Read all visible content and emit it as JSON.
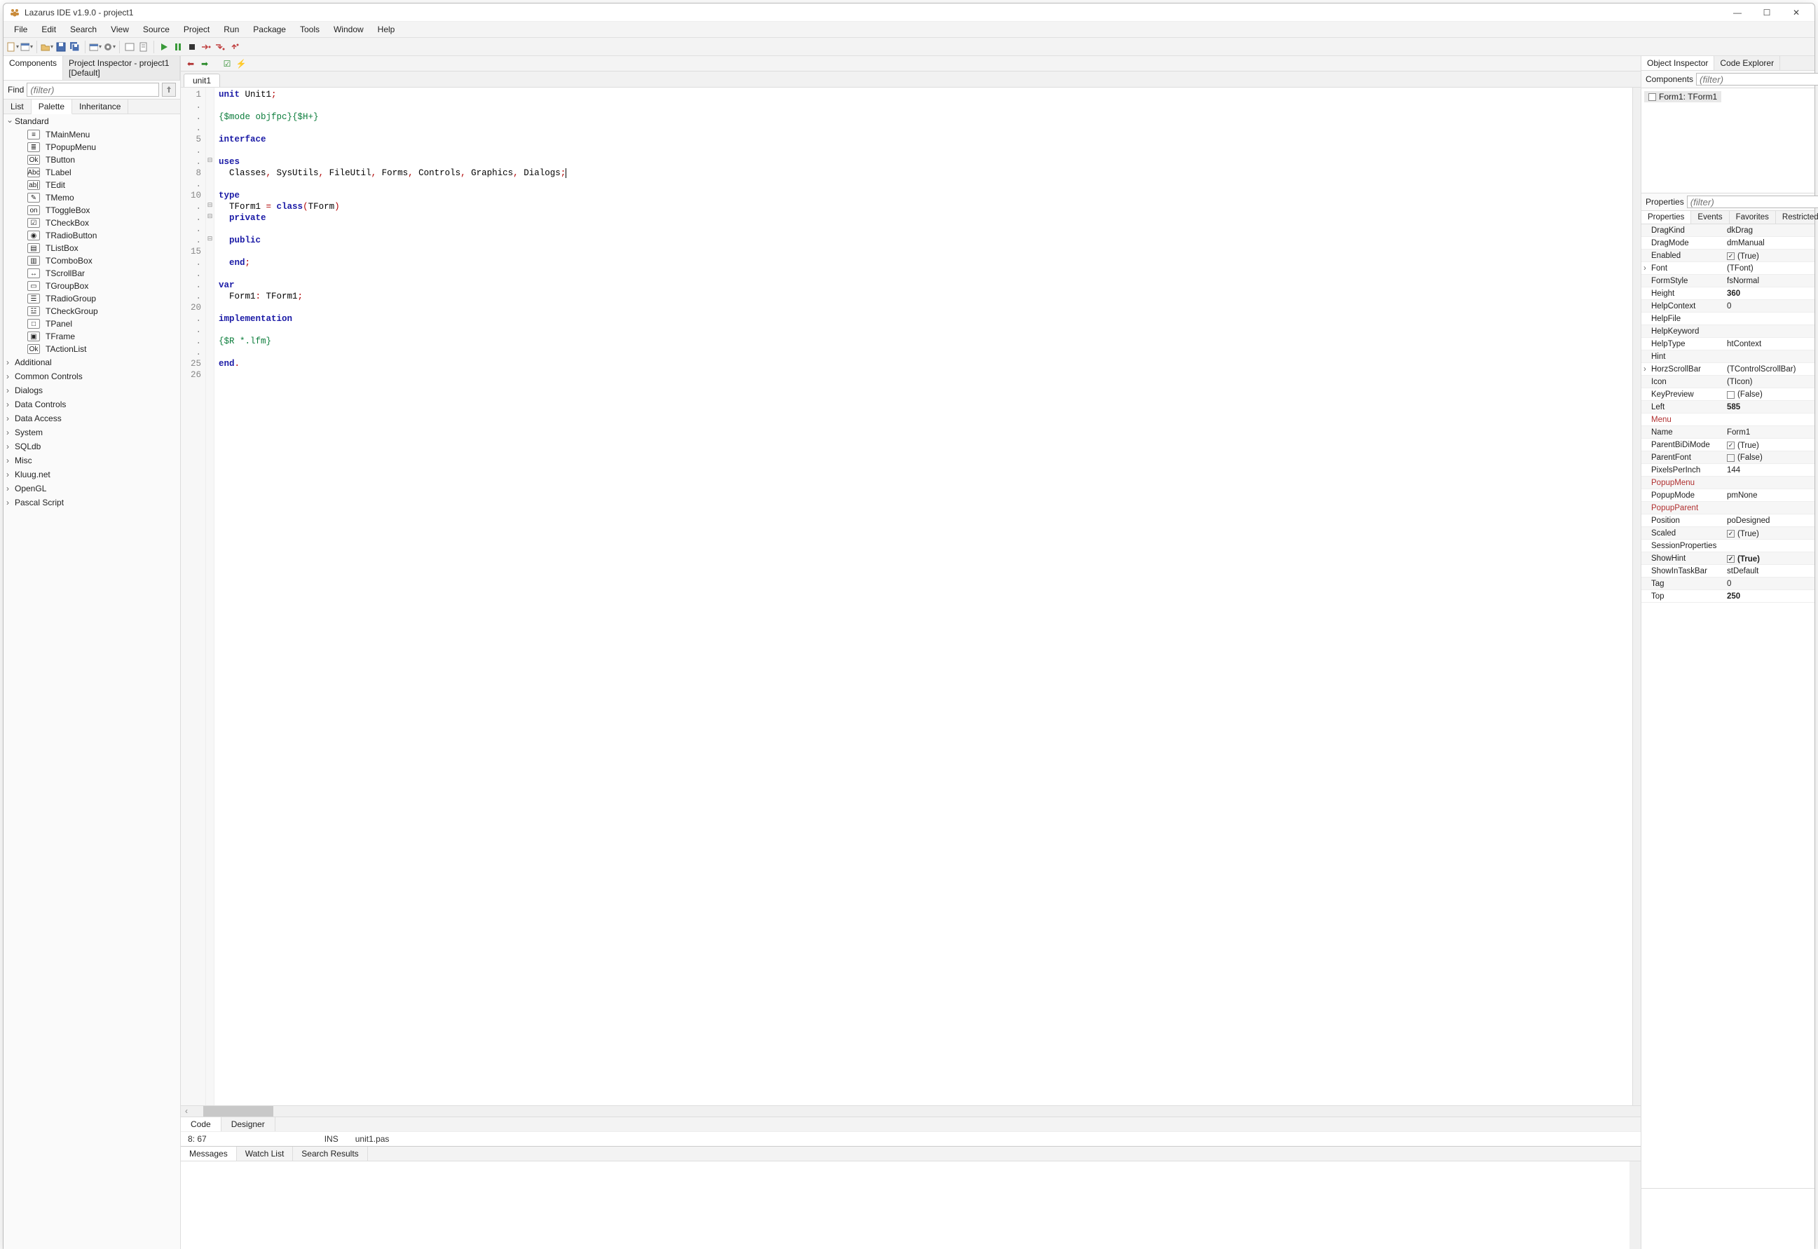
{
  "title": "Lazarus IDE v1.9.0 - project1",
  "menu": [
    "File",
    "Edit",
    "Search",
    "View",
    "Source",
    "Project",
    "Run",
    "Package",
    "Tools",
    "Window",
    "Help"
  ],
  "left": {
    "tabs": [
      "Components",
      "Project Inspector - project1 [Default]"
    ],
    "find_label": "Find",
    "find_placeholder": "(filter)",
    "lptabs": [
      "List",
      "Palette",
      "Inheritance"
    ],
    "groups": {
      "open": "Standard",
      "items": [
        {
          "icon": "≡",
          "label": "TMainMenu"
        },
        {
          "icon": "≣",
          "label": "TPopupMenu"
        },
        {
          "icon": "Ok",
          "label": "TButton"
        },
        {
          "icon": "Abc",
          "label": "TLabel"
        },
        {
          "icon": "ab|",
          "label": "TEdit"
        },
        {
          "icon": "✎",
          "label": "TMemo"
        },
        {
          "icon": "on",
          "label": "TToggleBox"
        },
        {
          "icon": "☑",
          "label": "TCheckBox"
        },
        {
          "icon": "◉",
          "label": "TRadioButton"
        },
        {
          "icon": "▤",
          "label": "TListBox"
        },
        {
          "icon": "▥",
          "label": "TComboBox"
        },
        {
          "icon": "↔",
          "label": "TScrollBar"
        },
        {
          "icon": "▭",
          "label": "TGroupBox"
        },
        {
          "icon": "☰",
          "label": "TRadioGroup"
        },
        {
          "icon": "☳",
          "label": "TCheckGroup"
        },
        {
          "icon": "□",
          "label": "TPanel"
        },
        {
          "icon": "▣",
          "label": "TFrame"
        },
        {
          "icon": "Ok",
          "label": "TActionList"
        }
      ],
      "closed": [
        "Additional",
        "Common Controls",
        "Dialogs",
        "Data Controls",
        "Data Access",
        "System",
        "SQLdb",
        "Misc",
        "Kluug.net",
        "OpenGL",
        "Pascal Script"
      ]
    }
  },
  "editor": {
    "nav_icons": [
      "back",
      "fwd",
      "sep",
      "check",
      "lightning"
    ],
    "tab": "unit1",
    "bottom_tabs": [
      "Code",
      "Designer"
    ],
    "status": {
      "pos": "8: 67",
      "ins": "INS",
      "file": "unit1.pas"
    },
    "lines": [
      {
        "n": "1",
        "f": "",
        "t": [
          [
            "kw",
            "unit"
          ],
          [
            "pl",
            " Unit1"
          ],
          [
            "sy",
            ";"
          ]
        ]
      },
      {
        "n": ".",
        "f": "",
        "t": []
      },
      {
        "n": ".",
        "f": "",
        "t": [
          [
            "cm",
            "{$mode objfpc}{$H+}"
          ]
        ]
      },
      {
        "n": ".",
        "f": "",
        "t": []
      },
      {
        "n": "5",
        "f": "",
        "t": [
          [
            "kw",
            "interface"
          ]
        ]
      },
      {
        "n": ".",
        "f": "",
        "t": []
      },
      {
        "n": ".",
        "f": "⊟",
        "t": [
          [
            "kw",
            "uses"
          ]
        ]
      },
      {
        "n": "8",
        "f": "",
        "t": [
          [
            "pl",
            "  Classes"
          ],
          [
            "sy",
            ","
          ],
          [
            "pl",
            " SysUtils"
          ],
          [
            "sy",
            ","
          ],
          [
            "pl",
            " FileUtil"
          ],
          [
            "sy",
            ","
          ],
          [
            "pl",
            " Forms"
          ],
          [
            "sy",
            ","
          ],
          [
            "pl",
            " Controls"
          ],
          [
            "sy",
            ","
          ],
          [
            "pl",
            " Graphics"
          ],
          [
            "sy",
            ","
          ],
          [
            "pl",
            " Dialogs"
          ],
          [
            "sy",
            ";"
          ],
          [
            "cursor",
            ""
          ]
        ]
      },
      {
        "n": ".",
        "f": "",
        "t": []
      },
      {
        "n": "10",
        "f": "",
        "t": [
          [
            "kw",
            "type"
          ]
        ]
      },
      {
        "n": ".",
        "f": "⊟",
        "t": [
          [
            "pl",
            "  TForm1 "
          ],
          [
            "sy",
            "="
          ],
          [
            "pl",
            " "
          ],
          [
            "kw",
            "class"
          ],
          [
            "sy",
            "("
          ],
          [
            "pl",
            "TForm"
          ],
          [
            "sy",
            ")"
          ]
        ]
      },
      {
        "n": ".",
        "f": "⊟",
        "t": [
          [
            "kw",
            "  private"
          ]
        ]
      },
      {
        "n": ".",
        "f": "",
        "t": []
      },
      {
        "n": ".",
        "f": "⊟",
        "t": [
          [
            "kw",
            "  public"
          ]
        ]
      },
      {
        "n": "15",
        "f": "",
        "t": []
      },
      {
        "n": ".",
        "f": "",
        "t": [
          [
            "kw",
            "  end"
          ],
          [
            "sy",
            ";"
          ]
        ]
      },
      {
        "n": ".",
        "f": "",
        "t": []
      },
      {
        "n": ".",
        "f": "",
        "t": [
          [
            "kw",
            "var"
          ]
        ]
      },
      {
        "n": ".",
        "f": "",
        "t": [
          [
            "pl",
            "  Form1"
          ],
          [
            "sy",
            ":"
          ],
          [
            "pl",
            " TForm1"
          ],
          [
            "sy",
            ";"
          ]
        ]
      },
      {
        "n": "20",
        "f": "",
        "t": []
      },
      {
        "n": ".",
        "f": "",
        "t": [
          [
            "kw",
            "implementation"
          ]
        ]
      },
      {
        "n": ".",
        "f": "",
        "t": []
      },
      {
        "n": ".",
        "f": "",
        "t": [
          [
            "cm",
            "{$R *.lfm}"
          ]
        ]
      },
      {
        "n": ".",
        "f": "",
        "t": []
      },
      {
        "n": "25",
        "f": "",
        "t": [
          [
            "kw",
            "end"
          ],
          [
            "sy",
            "."
          ]
        ]
      },
      {
        "n": "26",
        "f": "",
        "t": []
      }
    ]
  },
  "bottom_tabs": [
    "Messages",
    "Watch List",
    "Search Results"
  ],
  "right": {
    "tabs": [
      "Object Inspector",
      "Code Explorer"
    ],
    "comp_label": "Components",
    "filter_placeholder": "(filter)",
    "tree_node": "Form1: TForm1",
    "prop_label": "Properties",
    "pftabs": [
      "Properties",
      "Events",
      "Favorites",
      "Restricted"
    ],
    "props": [
      {
        "k": "DragKind",
        "v": "dkDrag"
      },
      {
        "k": "DragMode",
        "v": "dmManual"
      },
      {
        "k": "Enabled",
        "v": "(True)",
        "chk": true,
        "checked": true
      },
      {
        "k": "Font",
        "v": "(TFont)",
        "exp": true
      },
      {
        "k": "FormStyle",
        "v": "fsNormal"
      },
      {
        "k": "Height",
        "v": "360",
        "bold": true
      },
      {
        "k": "HelpContext",
        "v": "0"
      },
      {
        "k": "HelpFile",
        "v": ""
      },
      {
        "k": "HelpKeyword",
        "v": ""
      },
      {
        "k": "HelpType",
        "v": "htContext"
      },
      {
        "k": "Hint",
        "v": ""
      },
      {
        "k": "HorzScrollBar",
        "v": "(TControlScrollBar)",
        "exp": true
      },
      {
        "k": "Icon",
        "v": "(TIcon)"
      },
      {
        "k": "KeyPreview",
        "v": "(False)",
        "chk": true,
        "checked": false
      },
      {
        "k": "Left",
        "v": "585",
        "bold": true
      },
      {
        "k": "Menu",
        "v": "",
        "kred": true
      },
      {
        "k": "Name",
        "v": "Form1"
      },
      {
        "k": "ParentBiDiMode",
        "v": "(True)",
        "chk": true,
        "checked": true
      },
      {
        "k": "ParentFont",
        "v": "(False)",
        "chk": true,
        "checked": false
      },
      {
        "k": "PixelsPerInch",
        "v": "144"
      },
      {
        "k": "PopupMenu",
        "v": "",
        "kred": true
      },
      {
        "k": "PopupMode",
        "v": "pmNone"
      },
      {
        "k": "PopupParent",
        "v": "",
        "kred": true
      },
      {
        "k": "Position",
        "v": "poDesigned"
      },
      {
        "k": "Scaled",
        "v": "(True)",
        "chk": true,
        "checked": true
      },
      {
        "k": "SessionProperties",
        "v": ""
      },
      {
        "k": "ShowHint",
        "v": "(True)",
        "chk": true,
        "checked": true,
        "bold": true
      },
      {
        "k": "ShowInTaskBar",
        "v": "stDefault"
      },
      {
        "k": "Tag",
        "v": "0"
      },
      {
        "k": "Top",
        "v": "250",
        "bold": true
      }
    ]
  }
}
